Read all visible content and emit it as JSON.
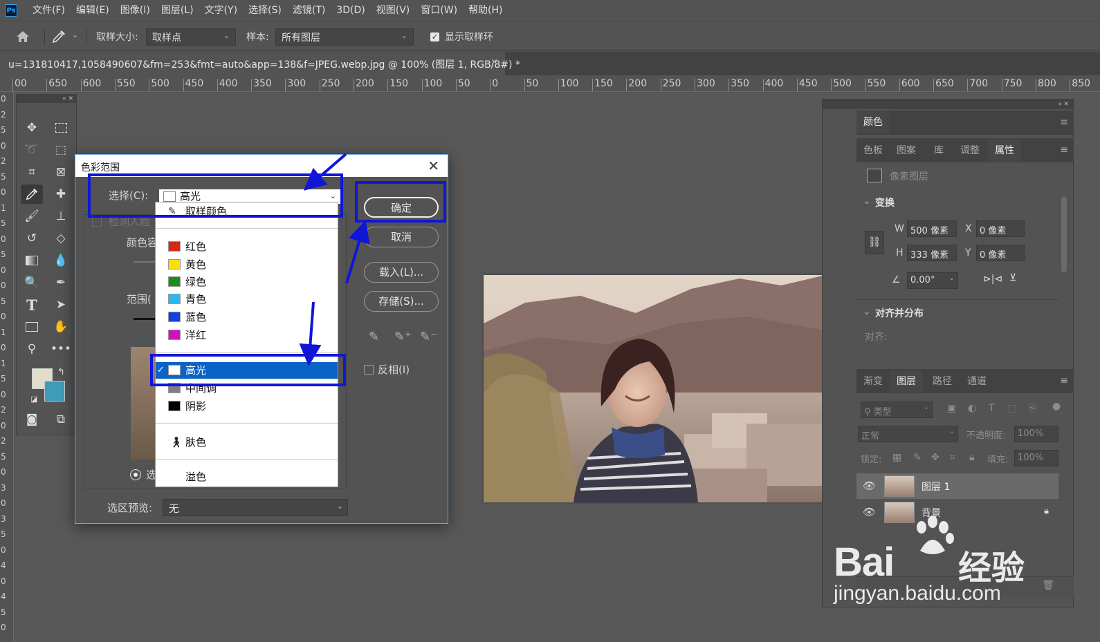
{
  "app": {
    "logo": "Ps"
  },
  "menu": [
    "文件(F)",
    "编辑(E)",
    "图像(I)",
    "图层(L)",
    "文字(Y)",
    "选择(S)",
    "滤镜(T)",
    "3D(D)",
    "视图(V)",
    "窗口(W)",
    "帮助(H)"
  ],
  "options": {
    "sample_size_label": "取样大小:",
    "sample_size_value": "取样点",
    "sample_label": "样本:",
    "sample_value": "所有图层",
    "show_ring_label": "显示取样环",
    "show_ring_checked": true
  },
  "document": {
    "tab_title": "u=131810417,1058490607&fm=253&fmt=auto&app=138&f=JPEG.webp.jpg @ 100% (图层 1, RGB/8#) *"
  },
  "ruler": {
    "top_labels": [
      "00",
      "650",
      "600",
      "550",
      "500",
      "450",
      "400",
      "350",
      "300",
      "250",
      "200",
      "150",
      "100",
      "50",
      "0",
      "50",
      "100",
      "150",
      "200",
      "250",
      "300",
      "350",
      "400",
      "450",
      "500",
      "550",
      "600",
      "650",
      "700",
      "750",
      "800",
      "850"
    ],
    "left_labels": [
      "0",
      "2",
      "5",
      "0",
      "2",
      "5",
      "0",
      "1",
      "5",
      "0",
      "5",
      "0",
      "0",
      "5",
      "0",
      "1",
      "0",
      "1",
      "5",
      "0",
      "2",
      "0",
      "2",
      "5",
      "0",
      "3",
      "0",
      "3",
      "5",
      "0",
      "4",
      "0",
      "4",
      "5",
      "0"
    ]
  },
  "dialog": {
    "title": "色彩范围",
    "select_label": "选择(C):",
    "select_value": "高光",
    "detect_faces": "检测人脸",
    "color_tolerance_label": "颜色容",
    "range_label": "范围(",
    "selection_radio_label": "选",
    "preview_label": "选区预览:",
    "preview_value": "无",
    "buttons": {
      "ok": "确定",
      "cancel": "取消",
      "load": "载入(L)...",
      "save": "存储(S)..."
    },
    "invert_label": "反相(I)"
  },
  "dropdown": {
    "sampled_colors": "取样颜色",
    "colors": [
      {
        "label": "红色",
        "swatch": "#d22a10"
      },
      {
        "label": "黄色",
        "swatch": "#f8e000"
      },
      {
        "label": "绿色",
        "swatch": "#1c8c1c"
      },
      {
        "label": "青色",
        "swatch": "#2bb8ee"
      },
      {
        "label": "蓝色",
        "swatch": "#1040e0"
      },
      {
        "label": "洋红",
        "swatch": "#d010c0"
      }
    ],
    "tones": [
      {
        "label": "高光",
        "swatch": "#ffffff",
        "selected": true
      },
      {
        "label": "中间调",
        "swatch": "#808080"
      },
      {
        "label": "阴影",
        "swatch": "#000000"
      }
    ],
    "skin_tones": "肤色",
    "out_of_gamut": "溢色"
  },
  "panel": {
    "top_tabs": [
      "颜色"
    ],
    "second_tabs": [
      "色板",
      "图案",
      "库",
      "调整",
      "属性"
    ],
    "active_second_tab": "属性",
    "pixel_layer_label": "像素图层",
    "transform": {
      "heading": "变换",
      "w_label": "W",
      "w_value": "500 像素",
      "x_label": "X",
      "x_value": "0 像素",
      "h_label": "H",
      "h_value": "333 像素",
      "y_label": "Y",
      "y_value": "0 像素",
      "angle_value": "0.00°"
    },
    "align": {
      "heading": "对齐并分布",
      "align_label": "对齐:"
    },
    "layers_tabs": [
      "渐变",
      "图层",
      "路径",
      "通道"
    ],
    "active_layers_tab": "图层",
    "kind_filter": "类型",
    "blend_mode": "正常",
    "opacity_label": "不透明度:",
    "opacity_value": "100%",
    "lock_label": "锁定:",
    "fill_label": "填充:",
    "fill_value": "100%",
    "layers": [
      {
        "name": "图层 1",
        "active": true
      },
      {
        "name": "背景",
        "locked": true
      }
    ]
  },
  "watermark": {
    "bai": "Bai",
    "cn": "经验",
    "url": "jingyan.baidu.com"
  }
}
